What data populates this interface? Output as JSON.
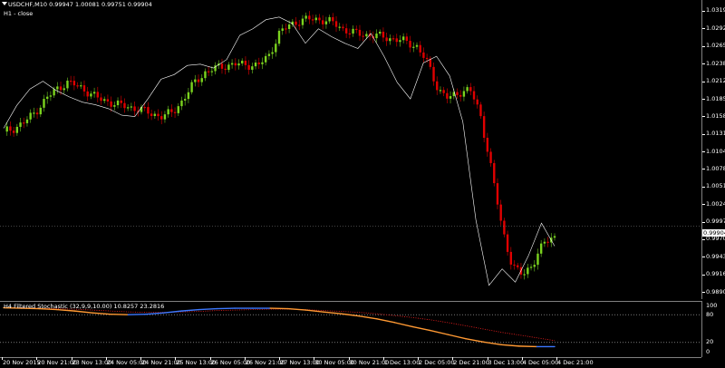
{
  "chart": {
    "symbol_header": "USDCHF,M10  0.99947 1.00081 0.99751 0.99904",
    "overlay_label": "H1 - close",
    "indicator_header": "H4 Filtered Stochastic (32,9,9,10.00) 10.8257 23.2816",
    "current_price": "0.99904"
  },
  "price_axis": [
    {
      "label": "1.03195",
      "y": 1.03195
    },
    {
      "label": "1.02925",
      "y": 1.02925
    },
    {
      "label": "1.02655",
      "y": 1.02655
    },
    {
      "label": "1.02385",
      "y": 1.02385
    },
    {
      "label": "1.02120",
      "y": 1.0212
    },
    {
      "label": "1.01850",
      "y": 1.0185
    },
    {
      "label": "1.01585",
      "y": 1.01585
    },
    {
      "label": "1.01315",
      "y": 1.01315
    },
    {
      "label": "1.01045",
      "y": 1.01045
    },
    {
      "label": "1.00780",
      "y": 1.0078
    },
    {
      "label": "1.00510",
      "y": 1.0051
    },
    {
      "label": "1.00240",
      "y": 1.0024
    },
    {
      "label": "0.99970",
      "y": 0.9997
    },
    {
      "label": "0.99705",
      "y": 0.99705
    },
    {
      "label": "0.99435",
      "y": 0.99435
    },
    {
      "label": "0.99165",
      "y": 0.99165
    },
    {
      "label": "0.98900",
      "y": 0.989
    }
  ],
  "indicator_axis": [
    {
      "label": "100",
      "y": 100
    },
    {
      "label": "80",
      "y": 80
    },
    {
      "label": "20",
      "y": 20
    },
    {
      "label": "0",
      "y": 0
    }
  ],
  "time_axis": [
    "20 Nov 2015",
    "20 Nov 21:00",
    "23 Nov 13:00",
    "24 Nov 05:00",
    "24 Nov 21:00",
    "25 Nov 13:00",
    "26 Nov 05:00",
    "26 Nov 21:00",
    "27 Nov 13:00",
    "30 Nov 05:00",
    "30 Nov 21:00",
    "1 Dec 13:00",
    "2 Dec 05:00",
    "2 Dec 21:00",
    "3 Dec 13:00",
    "4 Dec 05:00",
    "4 Dec 21:00"
  ],
  "chart_data": {
    "type": "line",
    "ylim": [
      0.989,
      1.0325
    ],
    "series": [
      {
        "values": [
          1.0135,
          1.014,
          1.015,
          1.0165,
          1.0185,
          1.02,
          1.021,
          1.0205,
          1.0195,
          1.0185,
          1.018,
          1.0175,
          1.0172,
          1.0168,
          1.0162,
          1.0158,
          1.0165,
          1.0185,
          1.021,
          1.0225,
          1.0232,
          1.0236,
          1.0238,
          1.0237,
          1.0236,
          1.025,
          1.0285,
          1.0298,
          1.0305,
          1.0307,
          1.0306,
          1.0302,
          1.0292,
          1.0286,
          1.0283,
          1.0282,
          1.0279,
          1.0276,
          1.0272,
          1.0265,
          1.024,
          1.02,
          1.0185,
          1.0195,
          1.02,
          1.016,
          1.008,
          0.999,
          0.993,
          0.9915,
          0.9935,
          0.9965,
          0.9975
        ]
      },
      {
        "values": [
          1.014,
          1.0175,
          1.02,
          1.0212,
          1.0198,
          1.0188,
          1.018,
          1.0176,
          1.017,
          1.016,
          1.0158,
          1.0185,
          1.0215,
          1.0222,
          1.0236,
          1.0238,
          1.0232,
          1.0245,
          1.0282,
          1.0292,
          1.0306,
          1.031,
          1.03,
          1.027,
          1.0292,
          1.028,
          1.027,
          1.0262,
          1.0285,
          1.025,
          1.021,
          1.0185,
          1.024,
          1.025,
          1.022,
          1.015,
          1.0,
          0.99,
          0.9925,
          0.9905,
          0.9945,
          0.9995,
          0.996
        ]
      },
      {
        "values": [
          95,
          94,
          93,
          91,
          88,
          84,
          81,
          80,
          81,
          84,
          88,
          91,
          93,
          94,
          94,
          94,
          93,
          90,
          86,
          82,
          77,
          71,
          63,
          54,
          46,
          37,
          28,
          21,
          15,
          12,
          11,
          11
        ]
      },
      {
        "values": [
          95,
          95,
          94,
          93,
          92,
          90,
          88,
          86,
          85,
          85,
          86,
          87,
          89,
          90,
          91,
          92,
          92,
          91,
          89,
          87,
          85,
          82,
          78,
          74,
          69,
          63,
          56,
          49,
          42,
          36,
          30,
          24
        ]
      }
    ]
  }
}
